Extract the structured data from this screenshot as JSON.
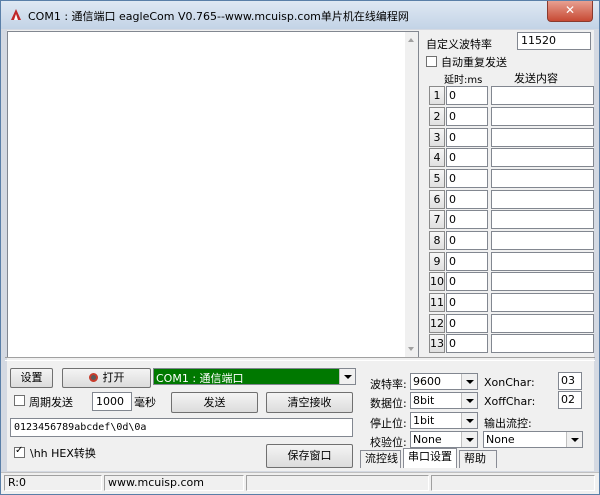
{
  "window": {
    "title": "COM1 : 通信端口  eagleCom V0.765--www.mcuisp.com单片机在线编程网",
    "close_label": "✕"
  },
  "right_panel": {
    "custom_baud_label": "自定义波特率",
    "custom_baud_value": "11520",
    "auto_repeat_label": "自动重复发送",
    "delay_header": "延时:ms",
    "content_header": "发送内容",
    "rows": [
      {
        "num": "1",
        "delay": "0",
        "content": ""
      },
      {
        "num": "2",
        "delay": "0",
        "content": ""
      },
      {
        "num": "3",
        "delay": "0",
        "content": ""
      },
      {
        "num": "4",
        "delay": "0",
        "content": ""
      },
      {
        "num": "5",
        "delay": "0",
        "content": ""
      },
      {
        "num": "6",
        "delay": "0",
        "content": ""
      },
      {
        "num": "7",
        "delay": "0",
        "content": ""
      },
      {
        "num": "8",
        "delay": "0",
        "content": ""
      },
      {
        "num": "9",
        "delay": "0",
        "content": ""
      },
      {
        "num": "10",
        "delay": "0",
        "content": ""
      },
      {
        "num": "11",
        "delay": "0",
        "content": ""
      },
      {
        "num": "12",
        "delay": "0",
        "content": ""
      },
      {
        "num": "13",
        "delay": "0",
        "content": ""
      }
    ]
  },
  "controls": {
    "settings_label": "设置",
    "open_label": "打开",
    "port_value": "COM1 : 通信端口",
    "periodic_send_label": "周期发送",
    "period_value": "1000",
    "period_unit": "毫秒",
    "send_label": "发送",
    "clear_recv_label": "清空接收",
    "send_text": "0123456789abcdef\\0d\\0a",
    "hex_convert_label": "\\hh HEX转换",
    "save_window_label": "保存窗口"
  },
  "serial": {
    "baud_label": "波特率:",
    "baud_value": "9600",
    "data_bits_label": "数据位:",
    "data_bits_value": "8bit",
    "stop_bits_label": "停止位:",
    "stop_bits_value": "1bit",
    "parity_label": "校验位:",
    "parity_value": "None",
    "xon_label": "XonChar:",
    "xon_value": "03",
    "xoff_label": "XoffChar:",
    "xoff_value": "02",
    "flow_label": "输出流控:",
    "flow_value": "None"
  },
  "tabs": [
    "流控线",
    "串口设置",
    "帮助"
  ],
  "status": {
    "rx": "R:0",
    "site": "www.mcuisp.com"
  },
  "colors": {
    "port_combo_bg": "#007800",
    "title_gradient_top": "#dfe8f3",
    "close_button": "#c74a34"
  }
}
